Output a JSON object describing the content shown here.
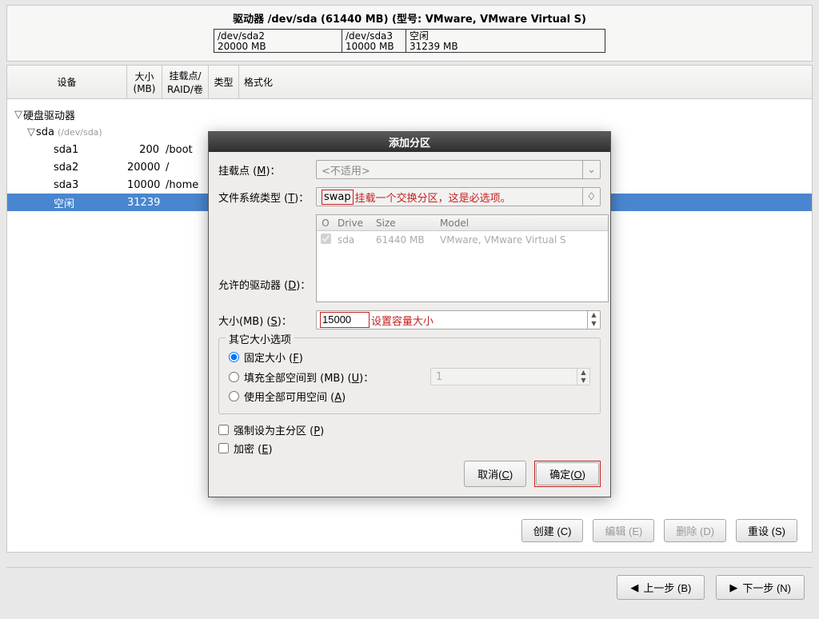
{
  "drive_header": {
    "title": "驱动器 /dev/sda (61440 MB) (型号: VMware, VMware Virtual S)",
    "segments": [
      {
        "name": "/dev/sda2",
        "size": "20000 MB"
      },
      {
        "name": "/dev/sda3",
        "size": "10000 MB"
      },
      {
        "name": "空闲",
        "size": "31239 MB"
      }
    ]
  },
  "columns": {
    "device": "设备",
    "size": "大小(MB)",
    "mount": "挂载点/\nRAID/卷",
    "type": "类型",
    "format": "格式化"
  },
  "tree": {
    "root": "硬盘驱动器",
    "disk": "sda",
    "disk_path": "(/dev/sda)",
    "rows": [
      {
        "dev": "sda1",
        "size": "200",
        "mnt": "/boot"
      },
      {
        "dev": "sda2",
        "size": "20000",
        "mnt": "/"
      },
      {
        "dev": "sda3",
        "size": "10000",
        "mnt": "/home"
      },
      {
        "dev": "空闲",
        "size": "31239",
        "mnt": ""
      }
    ]
  },
  "dialog": {
    "title": "添加分区",
    "mount_label": "挂载点 (M)：",
    "mount_value": "<不适用>",
    "fstype_label": "文件系统类型 (T)：",
    "fstype_value": "swap",
    "fstype_note": "挂载一个交换分区，这是必选项。",
    "allowable_label": "允许的驱动器 (D)：",
    "drives": {
      "h_o": "O",
      "h_drive": "Drive",
      "h_size": "Size",
      "h_model": "Model",
      "row": {
        "drive": "sda",
        "size": "61440 MB",
        "model": "VMware, VMware Virtual S"
      }
    },
    "size_label": "大小(MB) (S)：",
    "size_value": "15000",
    "size_note": "设置容量大小",
    "other_size_legend": "其它大小选项",
    "radio_fixed": "固定大小 (F)",
    "radio_fill": "填充全部空间到 (MB) (U)：",
    "radio_fill_val": "1",
    "radio_all": "使用全部可用空间 (A)",
    "chk_primary": "强制设为主分区 (P)",
    "chk_encrypt": "加密 (E)",
    "btn_cancel": "取消(C)",
    "btn_ok": "确定(O)"
  },
  "main_buttons": {
    "create": "创建 (C)",
    "edit": "编辑 (E)",
    "delete": "删除 (D)",
    "reset": "重设 (S)"
  },
  "nav": {
    "back": "上一步 (B)",
    "next": "下一步 (N)"
  }
}
